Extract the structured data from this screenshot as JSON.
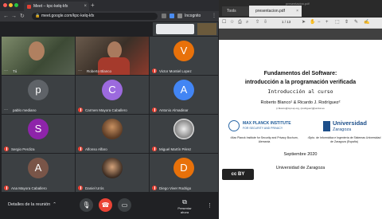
{
  "browser": {
    "tab_title": "Meet – kpc-kelq-kfx",
    "url": "meet.google.com/kpc-kelq-kfx",
    "incognito_label": "Incognito"
  },
  "meet": {
    "tiles": [
      {
        "name": "Tú",
        "kind": "video"
      },
      {
        "name": "Roberto Blanco",
        "kind": "video"
      },
      {
        "name": "Victor Montiel Lopez",
        "kind": "letter",
        "letter": "V",
        "color": "#e8710a"
      },
      {
        "name": "pablo mediano",
        "kind": "letter",
        "letter": "p",
        "color": "#5f6368"
      },
      {
        "name": "Carmen Mayora Caballero",
        "kind": "letter",
        "letter": "C",
        "color": "#9c6ade"
      },
      {
        "name": "Antonio Almadinar",
        "kind": "letter",
        "letter": "A",
        "color": "#4285f4"
      },
      {
        "name": "Sergio Perdiza",
        "kind": "letter",
        "letter": "S",
        "color": "#8e24aa"
      },
      {
        "name": "Alfonso Alfaro",
        "kind": "photo"
      },
      {
        "name": "Miguel Martín Pérez",
        "kind": "photo"
      },
      {
        "name": "Ana Mayora Caballero",
        "kind": "letter",
        "letter": "A",
        "color": "#795548"
      },
      {
        "name": "Daniel Urós",
        "kind": "photo"
      },
      {
        "name": "Diego Viver Rodrigo",
        "kind": "letter",
        "letter": "D",
        "color": "#e8710a"
      }
    ],
    "details_label": "Detalles de la reunión",
    "present_label": "Presentar ahora"
  },
  "pdf": {
    "window_title": "presentacion.pdf",
    "tools_label": "Tools",
    "tab_label": "presentacion.pdf",
    "page_indicator": "1 / 13",
    "title_line1": "Fundamentos del Software:",
    "title_line2": "introducción a la programación verificada",
    "subtitle": "Introducción al curso",
    "authors": "Roberto Blanco¹ & Ricardo J. Rodríguez²",
    "emails": "{r.blanco@mpi-sp.org, rjrodriguez}@unizar.es",
    "mpi_name": "MAX PLANCK INSTITUTE",
    "mpi_sub": "FOR SECURITY AND PRIVACY",
    "uz_name": "Universidad",
    "uz_sub": "Zaragoza",
    "affiliation1": "¹Max Planck Institute for Security and Privacy Bochum, Alemania",
    "affiliation2": "²Dpto. de Informática e Ingeniería de Sistemas Universidad de Zaragoza (España)",
    "date": "Septiembre 2020",
    "footer": "Universidad de Zaragoza",
    "license_badge": "cc BY"
  }
}
